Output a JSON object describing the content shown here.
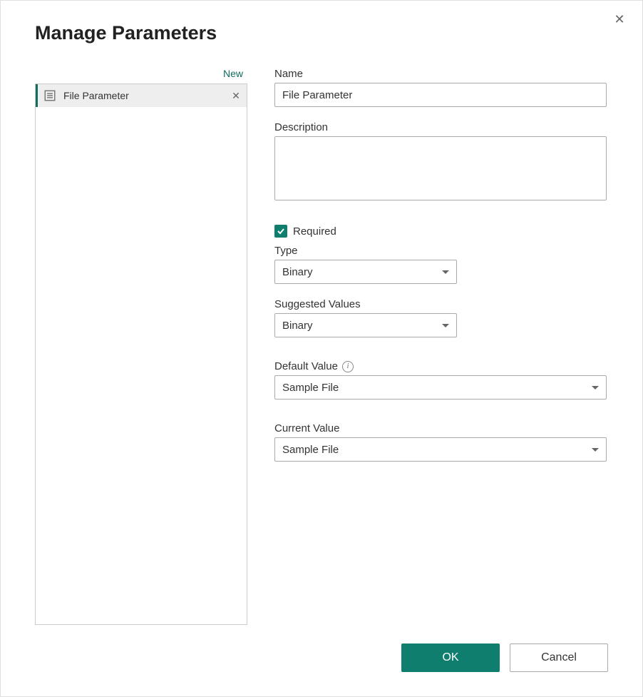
{
  "dialog": {
    "title": "Manage Parameters",
    "new_link": "New",
    "close_glyph": "✕"
  },
  "param_list": {
    "items": [
      {
        "label": "File Parameter",
        "selected": true
      }
    ]
  },
  "form": {
    "name_label": "Name",
    "name_value": "File Parameter",
    "description_label": "Description",
    "description_value": "",
    "required_label": "Required",
    "required_checked": true,
    "type_label": "Type",
    "type_value": "Binary",
    "suggested_label": "Suggested Values",
    "suggested_value": "Binary",
    "default_label": "Default Value",
    "default_value": "Sample File",
    "current_label": "Current Value",
    "current_value": "Sample File"
  },
  "footer": {
    "ok": "OK",
    "cancel": "Cancel"
  }
}
